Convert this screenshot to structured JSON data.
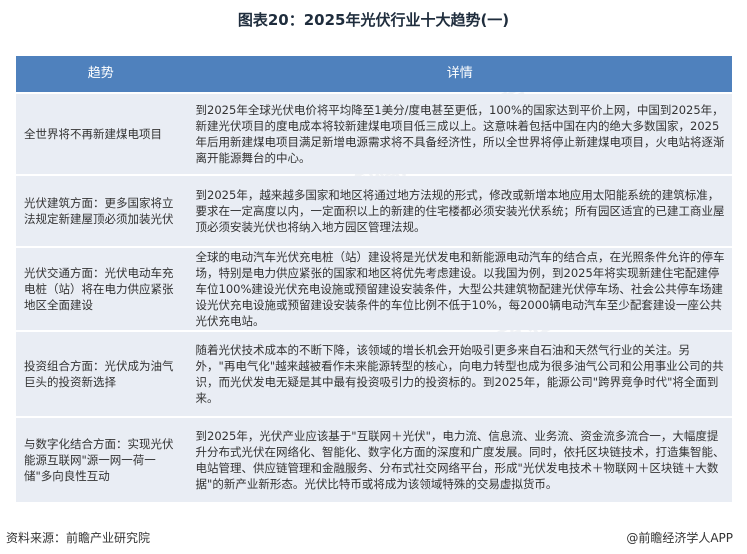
{
  "title": "图表20：2025年光伏行业十大趋势(一)",
  "table": {
    "headers": [
      "趋势",
      "详情"
    ],
    "rows": [
      {
        "trend": "全世界将不再新建煤电项目",
        "detail": "到2025年全球光伏电价将平均降至1美分/度电甚至更低，100%的国家达到平价上网，中国到2025年，新建光伏项目的度电成本将较新建煤电项目低三成以上。这意味着包括中国在内的绝大多数国家，2025年后用新建煤电项目满足新增电源需求将不具备经济性，所以全世界将停止新建煤电项目，火电站将逐渐离开能源舞台的中心。"
      },
      {
        "trend": "光伏建筑方面：更多国家将立法规定新建屋顶必须加装光伏",
        "detail": "到2025年，越来越多国家和地区将通过地方法规的形式，修改或新增本地应用太阳能系统的建筑标准，要求在一定高度以内，一定面积以上的新建的住宅楼都必须安装光伏系统；所有园区适宜的已建工商业屋顶必须安装光伏也将纳入地方园区管理法规。"
      },
      {
        "trend": "光伏交通方面：光伏电动车充电桩（站）将在电力供应紧张地区全面建设",
        "detail": "全球的电动汽车光伏充电桩（站）建设将是光伏发电和新能源电动汽车的结合点，在光照条件允许的停车场，特别是电力供应紧张的国家和地区将优先考虑建设。以我国为例，到2025年将实现新建住宅配建停车位100%建设光伏充电设施或预留建设安装条件，大型公共建筑物配建光伏停车场、社会公共停车场建设光伏充电设施或预留建设安装条件的车位比例不低于10%，每2000辆电动汽车至少配套建设一座公共光伏充电站。"
      },
      {
        "trend": "投资组合方面：光伏成为油气巨头的投资新选择",
        "detail": "随着光伏技术成本的不断下降，该领域的增长机会开始吸引更多来自石油和天然气行业的关注。另外，\"再电气化\"越来越被看作未来能源转型的核心，向电力转型也成为很多油气公司和公用事业公司的共识，而光伏发电无疑是其中最有投资吸引力的投资标的。到2025年，能源公司\"跨界竞争时代\"将全面到来。"
      },
      {
        "trend": "与数字化结合方面：实现光伏能源互联网\"源一网一荷一储\"多向良性互动",
        "detail": "到2025年，光伏产业应该基于\"互联网＋光伏\"，电力流、信息流、业务流、资金流多流合一，大幅度提升分布式光伏在网络化、智能化、数字化方面的深度和广度发展。同时，依托区块链技术，打造集智能、电站管理、供应链管理和金融服务、分布式社交网络平台，形成\"光伏发电技术＋物联网＋区块链＋大数据\"的新产业新形态。光伏比特币或将成为该领域特殊的交易虚拟货币。"
      }
    ]
  },
  "footer": {
    "source": "资料来源：前瞻产业研究院",
    "brand": "@前瞻经济学人APP"
  },
  "watermark": "前瞻产业研究院"
}
